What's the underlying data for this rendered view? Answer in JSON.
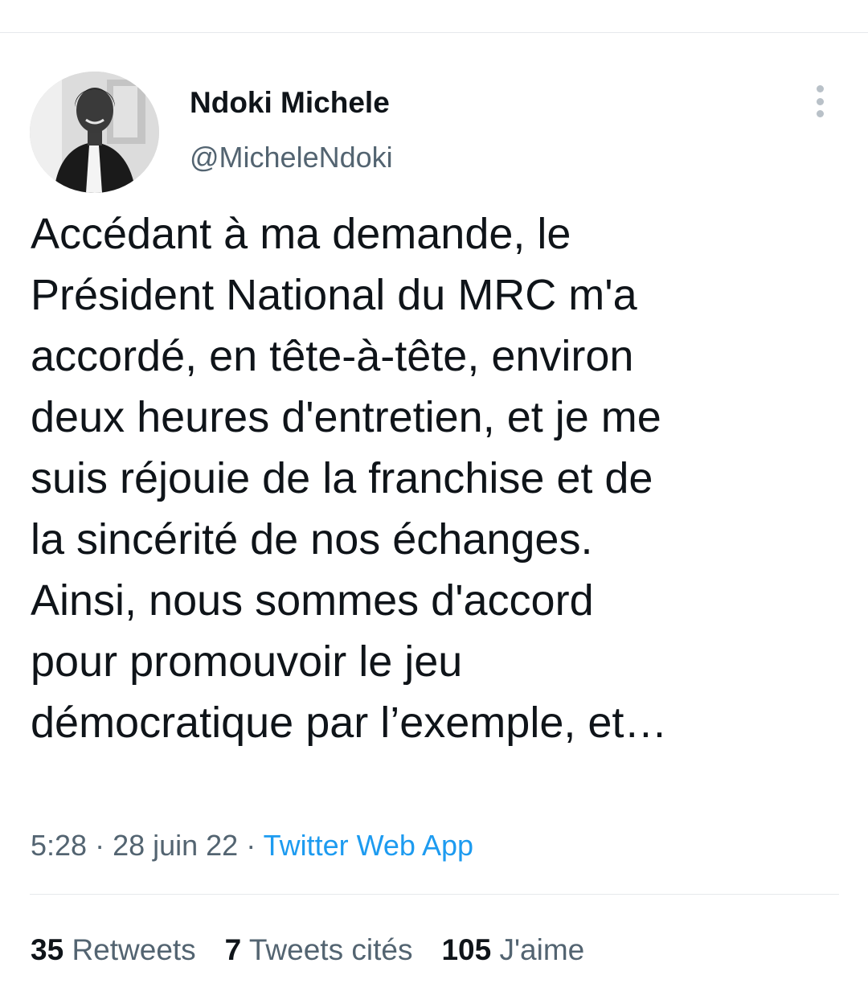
{
  "author": {
    "display_name": "Ndoki Michele",
    "handle": "@MicheleNdoki"
  },
  "tweet": {
    "text": "Accédant à ma demande, le\nPrésident National du MRC m'a\naccordé, en tête-à-tête, environ\ndeux heures d'entretien, et je me\nsuis réjouie de la franchise et de\nla sincérité de nos échanges.\nAinsi, nous sommes d'accord\npour promouvoir le jeu\ndémocratique par l’exemple, et…",
    "time": "5:28",
    "date": "28 juin 22",
    "separator": " · ",
    "source": "Twitter Web App"
  },
  "stats": [
    {
      "count": "35",
      "label": "Retweets"
    },
    {
      "count": "7",
      "label": "Tweets cités"
    },
    {
      "count": "105",
      "label": "J'aime"
    }
  ],
  "icons": {
    "more": "more-vertical-icon"
  },
  "colors": {
    "text": "#0f1419",
    "secondary": "#536471",
    "link": "#1d9bf0",
    "divider": "#e6e9ec"
  }
}
